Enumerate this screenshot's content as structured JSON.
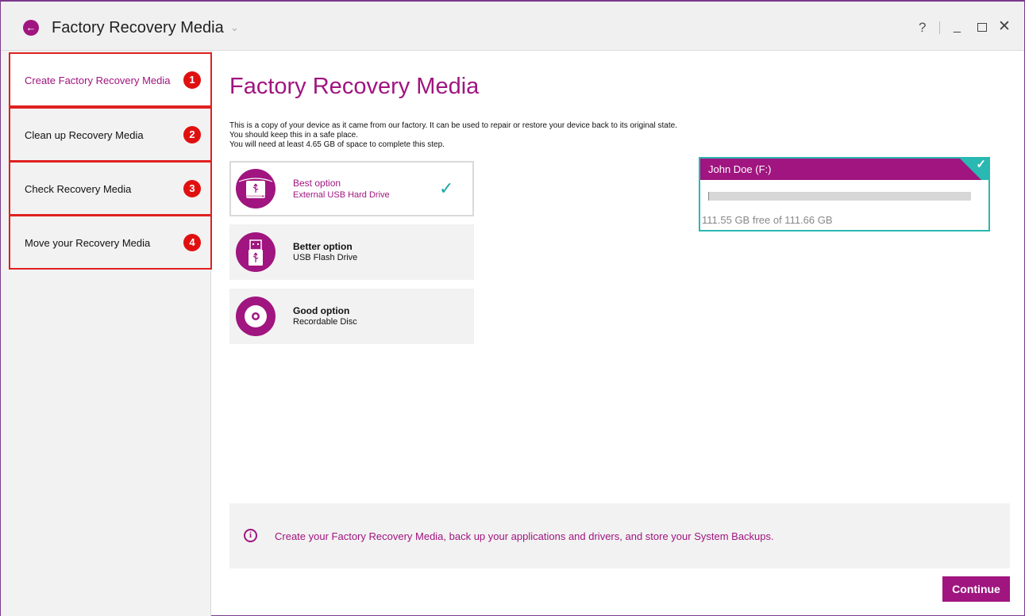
{
  "titlebar": {
    "title": "Factory Recovery Media",
    "back_icon": "arrow-left-icon",
    "chevron": "⌄",
    "help": "?",
    "minimize": "_",
    "close": "✕"
  },
  "sidebar": {
    "items": [
      {
        "label": "Create Factory Recovery Media",
        "num": "1",
        "active": true
      },
      {
        "label": "Clean up Recovery Media",
        "num": "2",
        "active": false
      },
      {
        "label": "Check Recovery Media",
        "num": "3",
        "active": false
      },
      {
        "label": "Move your Recovery Media",
        "num": "4",
        "active": false
      }
    ]
  },
  "main": {
    "title": "Factory Recovery Media",
    "description": [
      "This is a copy of your device as it came from our factory. It can be used to repair or restore your device back to its original state.",
      "You should keep this in a safe place.",
      "You will need at least 4.65 GB of space to complete this step."
    ],
    "options": [
      {
        "title": "Best option",
        "subtitle": "External USB Hard Drive",
        "icon": "external-hard-drive-icon",
        "selected": true
      },
      {
        "title": "Better option",
        "subtitle": "USB Flash Drive",
        "icon": "usb-flash-drive-icon",
        "selected": false
      },
      {
        "title": "Good option",
        "subtitle": "Recordable Disc",
        "icon": "disc-icon",
        "selected": false
      }
    ],
    "drive": {
      "name": "John Doe (F:)",
      "free_text": "111.55 GB free of 111.66 GB",
      "used_fraction": 0.001
    },
    "info": {
      "text": "Create your Factory Recovery Media, back up your applications and drivers, and store your System Backups."
    },
    "continue_label": "Continue"
  },
  "colors": {
    "accent": "#a0157f",
    "teal": "#2ab8b2",
    "badge_red": "#e01010"
  }
}
